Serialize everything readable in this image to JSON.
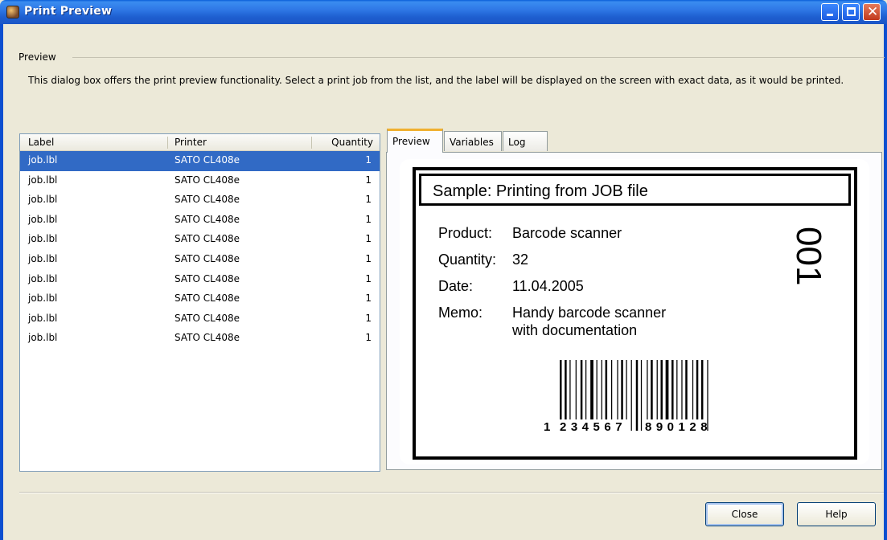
{
  "window": {
    "title": "Print Preview"
  },
  "group": {
    "label": "Preview",
    "description": "This dialog box offers the print preview functionality. Select a print job from the list, and the label will be displayed on the screen with exact data, as it would be printed."
  },
  "list": {
    "columns": [
      "Label",
      "Printer",
      "Quantity"
    ],
    "rows": [
      {
        "label": "job.lbl",
        "printer": "SATO CL408e",
        "quantity": "1",
        "selected": true
      },
      {
        "label": "job.lbl",
        "printer": "SATO CL408e",
        "quantity": "1"
      },
      {
        "label": "job.lbl",
        "printer": "SATO CL408e",
        "quantity": "1"
      },
      {
        "label": "job.lbl",
        "printer": "SATO CL408e",
        "quantity": "1"
      },
      {
        "label": "job.lbl",
        "printer": "SATO CL408e",
        "quantity": "1"
      },
      {
        "label": "job.lbl",
        "printer": "SATO CL408e",
        "quantity": "1"
      },
      {
        "label": "job.lbl",
        "printer": "SATO CL408e",
        "quantity": "1"
      },
      {
        "label": "job.lbl",
        "printer": "SATO CL408e",
        "quantity": "1"
      },
      {
        "label": "job.lbl",
        "printer": "SATO CL408e",
        "quantity": "1"
      },
      {
        "label": "job.lbl",
        "printer": "SATO CL408e",
        "quantity": "1"
      }
    ]
  },
  "tabs": [
    {
      "label": "Preview",
      "active": true
    },
    {
      "label": "Variables"
    },
    {
      "label": "Log"
    }
  ],
  "label_preview": {
    "title": "Sample: Printing from JOB file",
    "product_key": "Product:",
    "product_value": "Barcode scanner",
    "quantity_key": "Quantity:",
    "quantity_value": "32",
    "date_key": "Date:",
    "date_value": "11.04.2005",
    "memo_key": "Memo:",
    "memo_line1": "Handy barcode scanner",
    "memo_line2": "with documentation",
    "vertical_code": "001",
    "barcode_digits": {
      "first": "1",
      "left": "234567",
      "right": "890128"
    }
  },
  "buttons": {
    "close": "Close",
    "help": "Help"
  },
  "colors": {
    "selection": "#316ac5",
    "titlebar": "#2f78e6",
    "tab_highlight": "#f0b030"
  }
}
